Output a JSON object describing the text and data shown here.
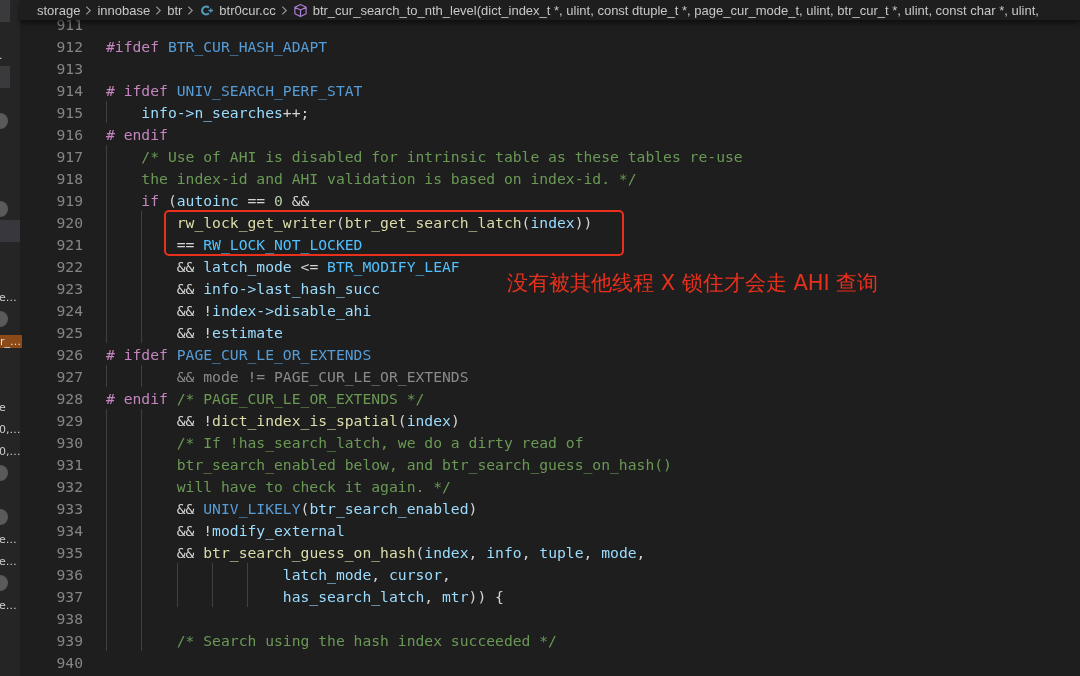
{
  "breadcrumb": [
    {
      "kind": "folder",
      "label": "storage"
    },
    {
      "kind": "folder",
      "label": "innobase"
    },
    {
      "kind": "folder",
      "label": "btr"
    },
    {
      "kind": "file",
      "label": "btr0cur.cc"
    },
    {
      "kind": "symbol",
      "label": "btr_cur_search_to_nth_level(dict_index_t *, ulint, const dtuple_t *, page_cur_mode_t, ulint, btr_cur_t *, ulint, const char *, ulint,"
    }
  ],
  "sidebar": {
    "items": [
      {
        "kind": "block"
      },
      {
        "kind": "text",
        "label": "."
      },
      {
        "kind": "block"
      },
      {
        "kind": "badge"
      },
      {
        "kind": "badge"
      },
      {
        "kind": "highlight"
      },
      {
        "kind": "text",
        "label": "e…"
      },
      {
        "kind": "badge"
      },
      {
        "kind": "match",
        "label": "r_…"
      },
      {
        "kind": "text",
        "label": "e"
      },
      {
        "kind": "text",
        "label": "0,…"
      },
      {
        "kind": "text",
        "label": "0,…"
      },
      {
        "kind": "badge"
      },
      {
        "kind": "badge"
      },
      {
        "kind": "text",
        "label": "e…"
      },
      {
        "kind": "text",
        "label": "e…"
      },
      {
        "kind": "badge"
      },
      {
        "kind": "text",
        "label": "e…"
      }
    ]
  },
  "editor": {
    "lines": [
      {
        "number": "911"
      },
      {
        "number": "912",
        "tokens": [
          {
            "kind": "pre",
            "text": "#ifdef "
          },
          {
            "kind": "macro",
            "text": "BTR_CUR_HASH_ADAPT"
          }
        ]
      },
      {
        "number": "913"
      },
      {
        "number": "914",
        "tokens": [
          {
            "kind": "pre",
            "text": "# ifdef "
          },
          {
            "kind": "macro",
            "text": "UNIV_SEARCH_PERF_STAT"
          }
        ]
      },
      {
        "number": "915",
        "tokens": [
          {
            "kind": "var",
            "text": "    info->n_searches"
          },
          {
            "kind": "plain",
            "text": "++;"
          }
        ]
      },
      {
        "number": "916",
        "tokens": [
          {
            "kind": "pre",
            "text": "# endif"
          }
        ]
      },
      {
        "number": "917",
        "tokens": [
          {
            "kind": "comment",
            "text": "    /* Use of AHI is disabled for intrinsic table as these tables re-use"
          }
        ]
      },
      {
        "number": "918",
        "tokens": [
          {
            "kind": "comment",
            "text": "    the index-id and AHI validation is based on index-id. */"
          }
        ]
      },
      {
        "number": "919",
        "tokens": [
          {
            "kind": "keyword",
            "text": "    if"
          },
          {
            "kind": "plain",
            "text": " ("
          },
          {
            "kind": "var",
            "text": "autoinc"
          },
          {
            "kind": "plain",
            "text": " == "
          },
          {
            "kind": "num",
            "text": "0"
          },
          {
            "kind": "plain",
            "text": " &&"
          }
        ]
      },
      {
        "number": "920",
        "tokens": [
          {
            "kind": "fn",
            "text": "        rw_lock_get_writer"
          },
          {
            "kind": "plain",
            "text": "("
          },
          {
            "kind": "fn",
            "text": "btr_get_search_latch"
          },
          {
            "kind": "plain",
            "text": "("
          },
          {
            "kind": "var",
            "text": "index"
          },
          {
            "kind": "plain",
            "text": "))"
          }
        ]
      },
      {
        "number": "921",
        "tokens": [
          {
            "kind": "plain",
            "text": "        == "
          },
          {
            "kind": "const",
            "text": "RW_LOCK_NOT_LOCKED"
          }
        ]
      },
      {
        "number": "922",
        "tokens": [
          {
            "kind": "plain",
            "text": "        && "
          },
          {
            "kind": "var",
            "text": "latch_mode"
          },
          {
            "kind": "plain",
            "text": " <= "
          },
          {
            "kind": "const",
            "text": "BTR_MODIFY_LEAF"
          }
        ]
      },
      {
        "number": "923",
        "tokens": [
          {
            "kind": "plain",
            "text": "        && "
          },
          {
            "kind": "var",
            "text": "info->last_hash_succ"
          }
        ]
      },
      {
        "number": "924",
        "tokens": [
          {
            "kind": "plain",
            "text": "        && !"
          },
          {
            "kind": "var",
            "text": "index->disable_ahi"
          }
        ]
      },
      {
        "number": "925",
        "tokens": [
          {
            "kind": "plain",
            "text": "        && !"
          },
          {
            "kind": "var",
            "text": "estimate"
          }
        ]
      },
      {
        "number": "926",
        "tokens": [
          {
            "kind": "pre",
            "text": "# ifdef "
          },
          {
            "kind": "macro",
            "text": "PAGE_CUR_LE_OR_EXTENDS"
          }
        ]
      },
      {
        "number": "927",
        "tokens": [
          {
            "kind": "inactive",
            "text": "        && mode != PAGE_CUR_LE_OR_EXTENDS"
          }
        ]
      },
      {
        "number": "928",
        "tokens": [
          {
            "kind": "pre",
            "text": "# endif "
          },
          {
            "kind": "comment",
            "text": "/* PAGE_CUR_LE_OR_EXTENDS */"
          }
        ]
      },
      {
        "number": "929",
        "tokens": [
          {
            "kind": "plain",
            "text": "        && !"
          },
          {
            "kind": "fn",
            "text": "dict_index_is_spatial"
          },
          {
            "kind": "plain",
            "text": "("
          },
          {
            "kind": "var",
            "text": "index"
          },
          {
            "kind": "plain",
            "text": ")"
          }
        ]
      },
      {
        "number": "930",
        "tokens": [
          {
            "kind": "comment",
            "text": "        /* If !has_search_latch, we do a dirty read of"
          }
        ]
      },
      {
        "number": "931",
        "tokens": [
          {
            "kind": "comment",
            "text": "        btr_search_enabled below, and btr_search_guess_on_hash()"
          }
        ]
      },
      {
        "number": "932",
        "tokens": [
          {
            "kind": "comment",
            "text": "        will have to check it again. */"
          }
        ]
      },
      {
        "number": "933",
        "tokens": [
          {
            "kind": "plain",
            "text": "        && "
          },
          {
            "kind": "macro",
            "text": "UNIV_LIKELY"
          },
          {
            "kind": "plain",
            "text": "("
          },
          {
            "kind": "var",
            "text": "btr_search_enabled"
          },
          {
            "kind": "plain",
            "text": ")"
          }
        ]
      },
      {
        "number": "934",
        "tokens": [
          {
            "kind": "plain",
            "text": "        && !"
          },
          {
            "kind": "var",
            "text": "modify_external"
          }
        ]
      },
      {
        "number": "935",
        "tokens": [
          {
            "kind": "plain",
            "text": "        && "
          },
          {
            "kind": "fn",
            "text": "btr_search_guess_on_hash"
          },
          {
            "kind": "plain",
            "text": "("
          },
          {
            "kind": "var",
            "text": "index"
          },
          {
            "kind": "plain",
            "text": ", "
          },
          {
            "kind": "var",
            "text": "info"
          },
          {
            "kind": "plain",
            "text": ", "
          },
          {
            "kind": "var",
            "text": "tuple"
          },
          {
            "kind": "plain",
            "text": ", "
          },
          {
            "kind": "var",
            "text": "mode"
          },
          {
            "kind": "plain",
            "text": ","
          }
        ]
      },
      {
        "number": "936",
        "tokens": [
          {
            "kind": "var",
            "text": "                    latch_mode"
          },
          {
            "kind": "plain",
            "text": ", "
          },
          {
            "kind": "var",
            "text": "cursor"
          },
          {
            "kind": "plain",
            "text": ","
          }
        ]
      },
      {
        "number": "937",
        "tokens": [
          {
            "kind": "var",
            "text": "                    has_search_latch"
          },
          {
            "kind": "plain",
            "text": ", "
          },
          {
            "kind": "var",
            "text": "mtr"
          },
          {
            "kind": "plain",
            "text": ")) {"
          }
        ]
      },
      {
        "number": "938"
      },
      {
        "number": "939",
        "tokens": [
          {
            "kind": "comment",
            "text": "        /* Search using the hash index succeeded */"
          }
        ]
      },
      {
        "number": "940"
      }
    ],
    "annotation": {
      "text": "没有被其他线程 X 锁住才会走 AHI 查询"
    }
  }
}
